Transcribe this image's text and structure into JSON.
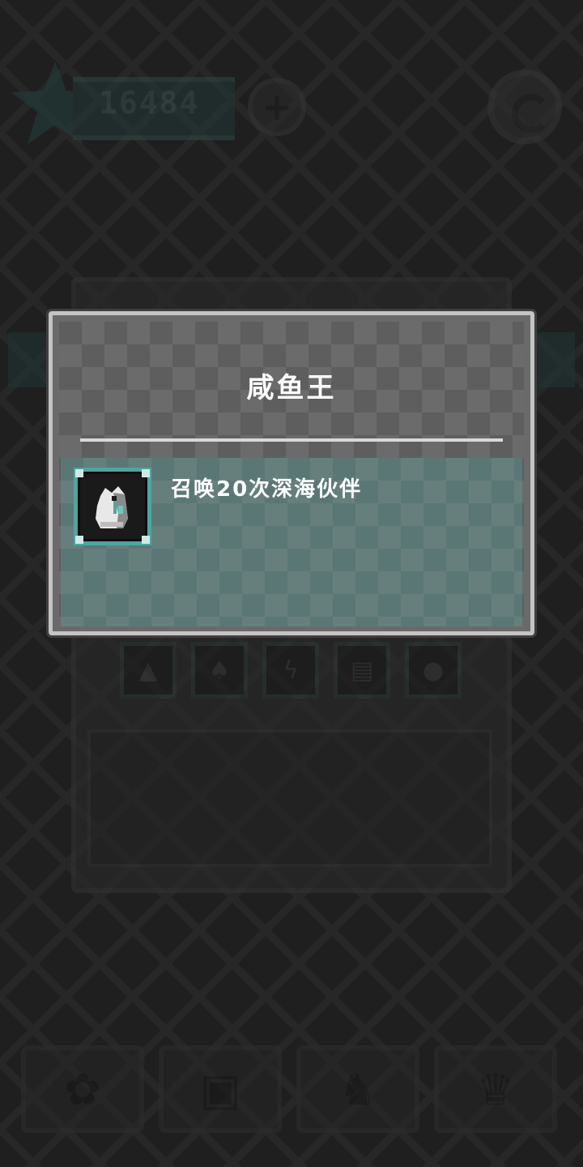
{
  "header": {
    "score": "16484",
    "star_icon": "star-icon",
    "add_icon": "plus-icon",
    "menu_icon": "spiral-icon"
  },
  "background_panel": {
    "slots": [
      {
        "icon": "tent-icon",
        "glyph": "▲"
      },
      {
        "icon": "beast-icon",
        "glyph": "♠"
      },
      {
        "icon": "lightning-icon",
        "glyph": "ϟ"
      },
      {
        "icon": "card-icon",
        "glyph": "▤"
      },
      {
        "icon": "orb-icon",
        "glyph": "●"
      }
    ]
  },
  "bottom_nav": {
    "tabs": [
      {
        "icon": "character-icon",
        "glyph": "✿"
      },
      {
        "icon": "chest-icon",
        "glyph": "▣"
      },
      {
        "icon": "monster-icon",
        "glyph": "♞"
      },
      {
        "icon": "trophy-icon",
        "glyph": "♛"
      }
    ]
  },
  "dialog": {
    "title": "咸鱼王",
    "entry": {
      "icon": "deep-sea-companion-icon",
      "text": "召唤20次深海伙伴"
    }
  },
  "colors": {
    "background": "#1f1f1f",
    "dialog_border": "#c4c4c4",
    "entry_bg": "#5b7775",
    "icon_frame": "#4fa5a0"
  }
}
